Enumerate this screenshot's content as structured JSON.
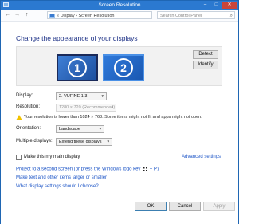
{
  "window": {
    "title": "Screen Resolution",
    "controls": {
      "minimize": "–",
      "maximize": "□",
      "close": "✕"
    }
  },
  "nav": {
    "back": "←",
    "forward": "→",
    "up": "↑",
    "address": "« Display › Screen Resolution",
    "search_placeholder": "Search Control Panel"
  },
  "main": {
    "heading": "Change the appearance of your displays",
    "monitors": [
      "1",
      "2"
    ],
    "detect_label": "Detect",
    "identify_label": "Identify",
    "display_label": "Display:",
    "display_value": "2. VUFINE 1.3",
    "resolution_label": "Resolution:",
    "resolution_value": "1280 × 720 (Recommended)",
    "warning_text": "Your resolution is lower than 1024 × 768. Some items might not fit and apps might not open.",
    "orientation_label": "Orientation:",
    "orientation_value": "Landscape",
    "multiple_label": "Multiple displays:",
    "multiple_value": "Extend these displays",
    "main_display_label": "Make this my main display",
    "advanced_link": "Advanced settings",
    "link_project": "Project to a second screen (or press the Windows logo key",
    "link_project_suffix": "+ P)",
    "link_text_size": "Make text and other items larger or smaller",
    "link_which": "What display settings should I choose?"
  },
  "footer": {
    "ok": "OK",
    "cancel": "Cancel",
    "apply": "Apply"
  },
  "colors": {
    "titlebar": "#2b79d0",
    "heading": "#1e3287",
    "link": "#1e56c7",
    "monitor_selected": "#2f79da"
  }
}
